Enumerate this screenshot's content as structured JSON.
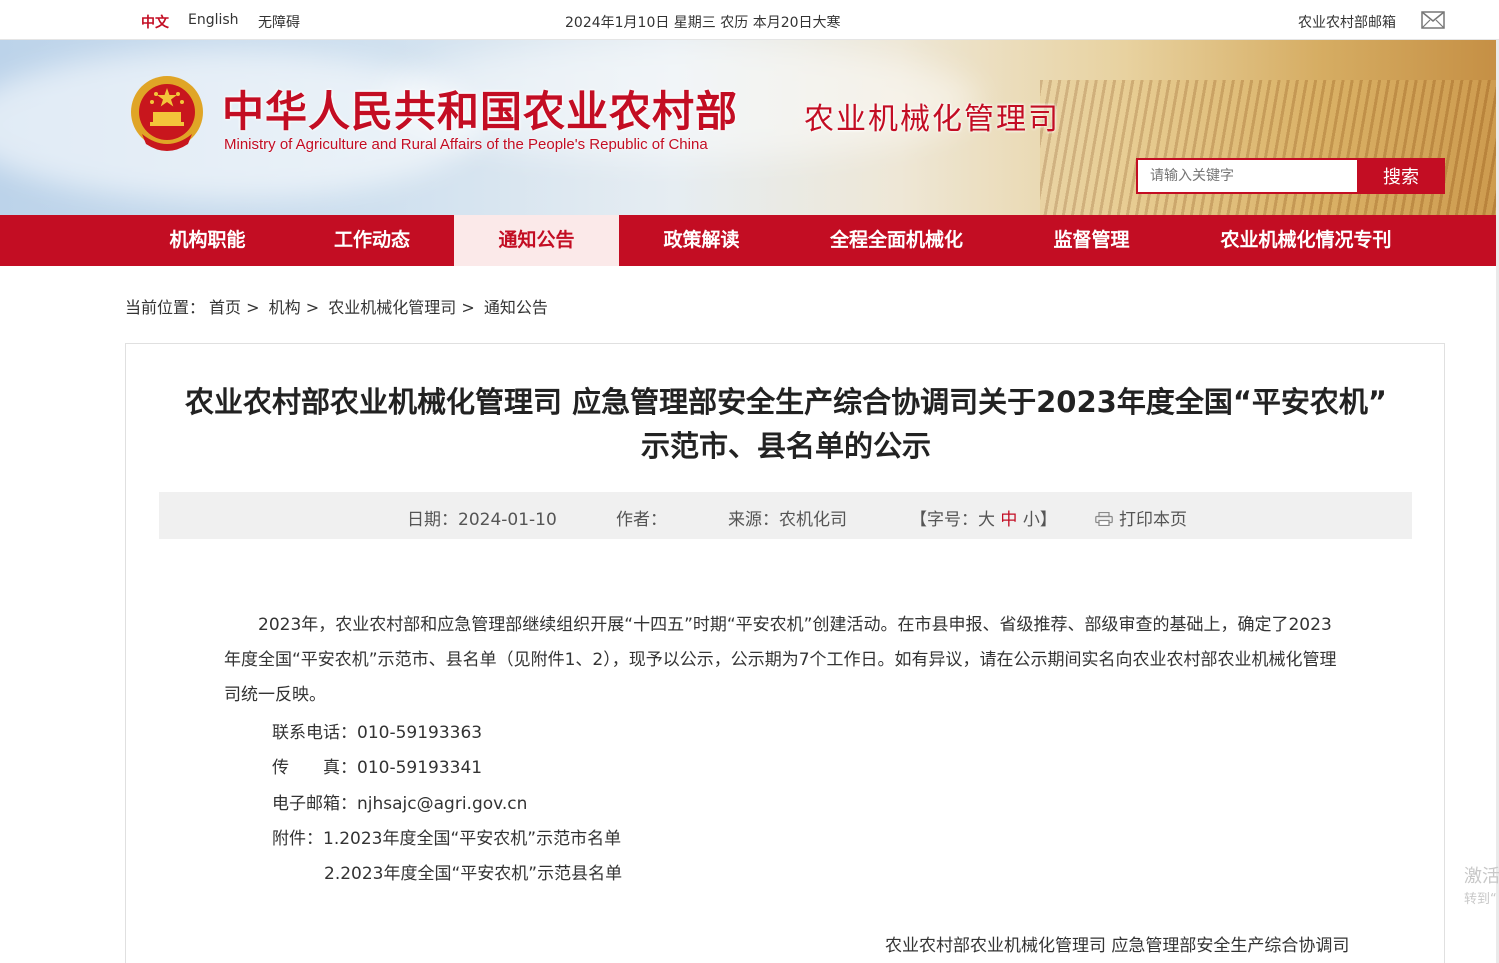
{
  "topbar": {
    "lang_zh": "中文",
    "lang_en": "English",
    "accessibility": "无障碍",
    "date": "2024年1月10日 星期三 农历 本月20日大寒",
    "mailbox": "农业农村部邮箱",
    "mail_icon": "mail-icon"
  },
  "header": {
    "emblem_icon": "national-emblem-icon",
    "site_title": "中华人民共和国农业农村部",
    "site_subtitle": "Ministry of Agriculture and Rural Affairs of the People's Republic of China",
    "dept_title": "农业机械化管理司",
    "search_placeholder": "请输入关键字",
    "search_button": "搜索"
  },
  "nav": {
    "items": [
      {
        "label": "机构职能",
        "active": false
      },
      {
        "label": "工作动态",
        "active": false
      },
      {
        "label": "通知公告",
        "active": true
      },
      {
        "label": "政策解读",
        "active": false
      },
      {
        "label": "全程全面机械化",
        "active": false
      },
      {
        "label": "监督管理",
        "active": false
      },
      {
        "label": "农业机械化情况专刊",
        "active": false
      }
    ]
  },
  "breadcrumb": {
    "prefix": "当前位置：",
    "items": [
      "首页",
      "机构",
      "农业机械化管理司",
      "通知公告"
    ],
    "separator": ">"
  },
  "article": {
    "title": "农业农村部农业机械化管理司 应急管理部安全生产综合协调司关于2023年度全国“平安农机” 示范市、县名单的公示",
    "meta": {
      "date_label": "日期：",
      "date": "2024-01-10",
      "author_label": "作者：",
      "author": "",
      "source_label": "来源：",
      "source": "农机化司",
      "font_size_prefix": "【字号：",
      "size_large": "大",
      "size_medium": "中",
      "size_small": "小",
      "font_size_suffix": "】",
      "print_icon": "printer-icon",
      "print_label": "打印本页"
    },
    "paragraph": "2023年，农业农村部和应急管理部继续组织开展“十四五”时期“平安农机”创建活动。在市县申报、省级推荐、部级审查的基础上，确定了2023年度全国“平安农机”示范市、县名单（见附件1、2），现予以公示，公示期为7个工作日。如有异议，请在公示期间实名向农业农村部农业机械化管理司统一反映。",
    "phone": "联系电话：010-59193363",
    "fax_label": "传　　真：",
    "fax": "010-59193341",
    "email": "电子邮箱：njhsajc@agri.gov.cn",
    "attachment_1": "附件：1.2023年度全国“平安农机”示范市名单",
    "attachment_2": "2.2023年度全国“平安农机”示范县名单",
    "signature": "农业农村部农业机械化管理司 应急管理部安全生产综合协调司"
  },
  "watermark": {
    "line1": "激活",
    "line2": "转到“"
  },
  "colors": {
    "brand_red": "#c30d23",
    "nav_active_bg": "#fbe9e9",
    "meta_bg": "#f0f0f0"
  }
}
